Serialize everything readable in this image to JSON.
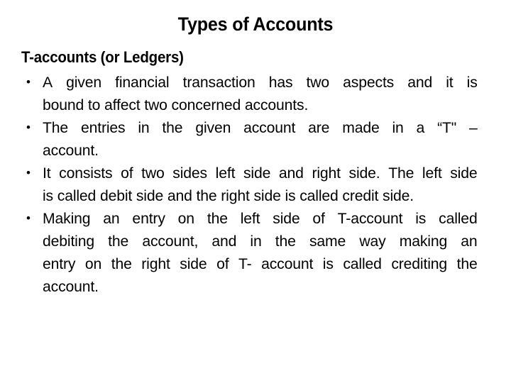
{
  "slide": {
    "title": "Types of Accounts",
    "sub_heading": "T-accounts (or Ledgers)",
    "bullet_marker": "•",
    "background_color": "#ffffff",
    "text_color": "#000000",
    "bullets": [
      {
        "text": "A given financial transaction has two aspects and it is bound to affect two concerned accounts.",
        "lines": [
          {
            "words": [
              "A",
              "given",
              "financial",
              "transaction",
              "has",
              "two",
              "aspects",
              "and",
              "it",
              "is"
            ],
            "justified": true
          },
          {
            "words": [
              "bound",
              "to",
              "affect",
              "two",
              "concerned",
              "accounts."
            ],
            "justified": false
          }
        ]
      },
      {
        "text": "The entries in the given account are made in a “T\" – account.",
        "lines": [
          {
            "words": [
              "The",
              "entries",
              "in",
              "the",
              "given",
              "account",
              "are",
              "made",
              "in",
              "a",
              "“T\"",
              "–"
            ],
            "justified": true
          },
          {
            "words": [
              "account."
            ],
            "justified": false
          }
        ]
      },
      {
        "text": "It consists of two sides left side and right side. The left side is called debit side and the right side is called credit side.",
        "lines": [
          {
            "words": [
              "It",
              "consists",
              "of",
              "two",
              "sides",
              "left",
              "side",
              "and",
              "right",
              "side.",
              "The",
              "left",
              "side"
            ],
            "justified": true
          },
          {
            "words": [
              "is",
              "called",
              "debit",
              "side",
              "and",
              "the",
              "right",
              "side",
              "is",
              "called",
              "credit",
              "side."
            ],
            "justified": false
          }
        ]
      },
      {
        "text": "Making an entry on the left side of T-account is called debiting the account, and in the same way making an entry on the right side of T- account is called crediting the account.",
        "lines": [
          {
            "words": [
              "Making",
              "an",
              "entry",
              "on",
              "the",
              "left",
              "side",
              "of",
              "T-account",
              "is",
              "called"
            ],
            "justified": true
          },
          {
            "words": [
              "debiting",
              "the",
              "account,",
              "and",
              "in",
              "the",
              "same",
              "way",
              "making",
              "an"
            ],
            "justified": true
          },
          {
            "words": [
              "entry",
              "on",
              "the",
              "right",
              "side",
              "of",
              "T-",
              "account",
              "is",
              "called",
              "crediting",
              "the"
            ],
            "justified": true
          },
          {
            "words": [
              "account."
            ],
            "justified": false
          }
        ]
      }
    ]
  }
}
